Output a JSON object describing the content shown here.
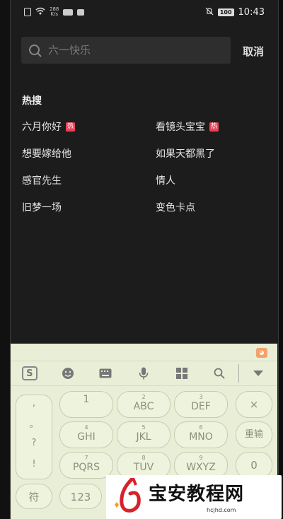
{
  "status_bar": {
    "speed_top": "288",
    "speed_unit": "K/s",
    "battery": "100",
    "time": "10:43"
  },
  "search": {
    "placeholder": "六一快乐",
    "cancel_label": "取消"
  },
  "hot_search": {
    "title": "热搜",
    "tag_label": "热",
    "items": [
      {
        "label": "六月你好",
        "hot": true
      },
      {
        "label": "看镜头宝宝",
        "hot": true
      },
      {
        "label": "想要嫁给他",
        "hot": false
      },
      {
        "label": "如果天都黑了",
        "hot": false
      },
      {
        "label": "感官先生",
        "hot": false
      },
      {
        "label": "情人",
        "hot": false
      },
      {
        "label": "旧梦一场",
        "hot": false
      },
      {
        "label": "变色卡点",
        "hot": false
      }
    ]
  },
  "keyboard": {
    "logo": "S",
    "punctuation": [
      ",",
      "。",
      "?",
      "!"
    ],
    "keys": [
      {
        "num": "",
        "text": "1"
      },
      {
        "num": "2",
        "text": "ABC"
      },
      {
        "num": "3",
        "text": "DEF"
      },
      {
        "num": "",
        "text": "×"
      },
      {
        "num": "4",
        "text": "GHI"
      },
      {
        "num": "5",
        "text": "JKL"
      },
      {
        "num": "6",
        "text": "MNO"
      },
      {
        "num": "",
        "text": "重输"
      },
      {
        "num": "7",
        "text": "PQRS"
      },
      {
        "num": "8",
        "text": "TUV"
      },
      {
        "num": "9",
        "text": "WXYZ"
      },
      {
        "num": "",
        "text": "0"
      }
    ],
    "symbol_key": "符",
    "num_key": "123"
  },
  "watermark": {
    "text": "宝安教程网",
    "url": "hcjhd.com"
  }
}
